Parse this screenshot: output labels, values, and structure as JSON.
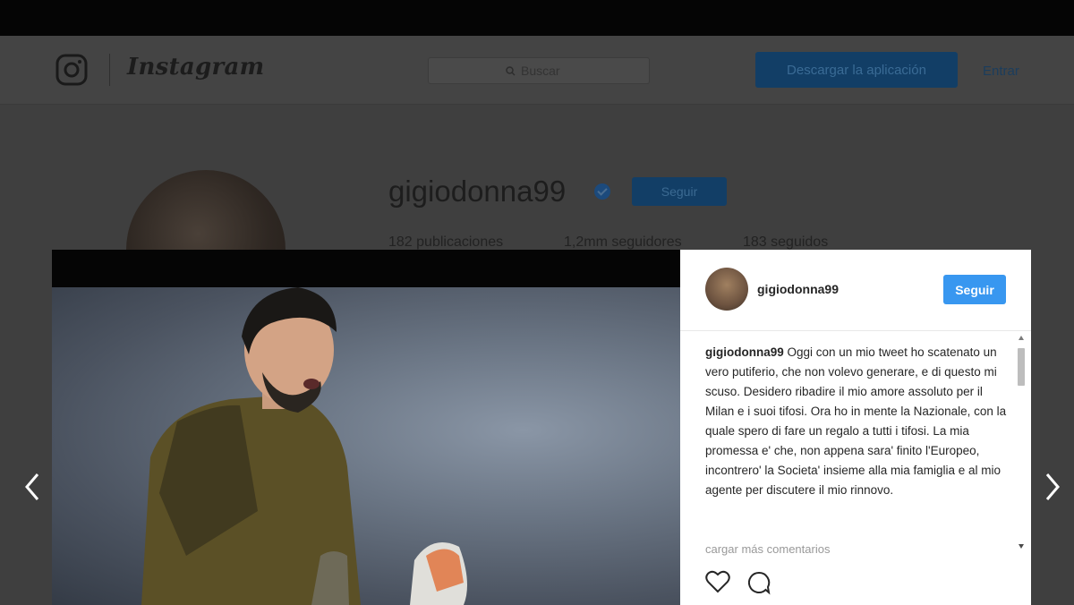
{
  "header": {
    "wordmark": "Instagram",
    "search_placeholder": "Buscar",
    "download_label": "Descargar la aplicación",
    "login_label": "Entrar"
  },
  "profile": {
    "username": "gigiodonna99",
    "follow_label": "Seguir",
    "stats": [
      {
        "value": "182",
        "label": "publicaciones"
      },
      {
        "value": "1,2mm",
        "label": "seguidores"
      },
      {
        "value": "183",
        "label": "seguidos"
      }
    ]
  },
  "post": {
    "username": "gigiodonna99",
    "follow_label": "Seguir",
    "caption_user": "gigiodonna99",
    "caption_text": "Oggi con un mio tweet ho scatenato un vero putiferio, che non volevo generare, e di questo mi scuso. Desidero ribadire il mio amore assoluto per il Milan e i suoi tifosi. Ora ho in mente la Nazionale, con la quale spero di fare un regalo a tutti i tifosi. La mia promessa e' che, non appena sara' finito l'Europeo, incontrero' la Societa' insieme alla mia famiglia e al mio agente per discutere il mio rinnovo.",
    "load_more_label": "cargar más comentarios"
  },
  "icons": {
    "heart": "heart-icon",
    "comment": "comment-icon",
    "prev": "chevron-left-icon",
    "next": "chevron-right-icon"
  },
  "colors": {
    "follow_blue": "#3897f0",
    "overlay_dark": "#3f3f3f"
  }
}
